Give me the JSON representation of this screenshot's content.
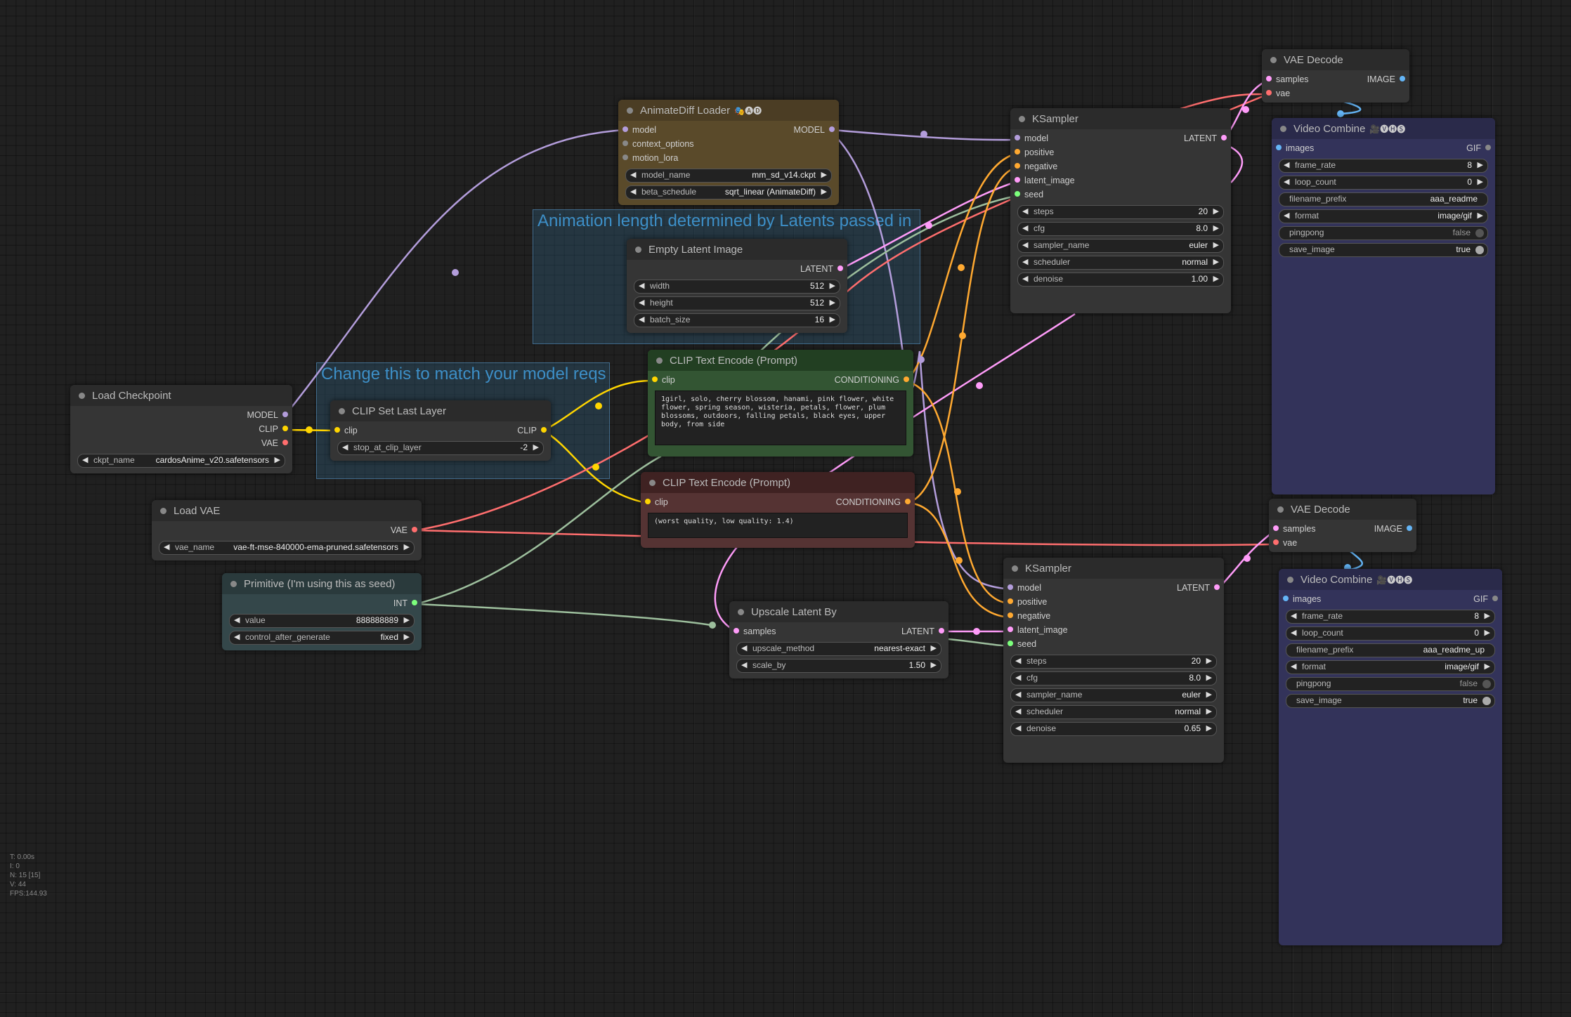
{
  "groups": {
    "animation": {
      "title": "Animation length determined by Latents passed in"
    },
    "change": {
      "title": "Change this to match your model reqs"
    }
  },
  "nodes": {
    "load_checkpoint": {
      "title": "Load Checkpoint",
      "outputs": [
        "MODEL",
        "CLIP",
        "VAE"
      ],
      "ckpt_name_label": "ckpt_name",
      "ckpt_name": "cardosAnime_v20.safetensors"
    },
    "clip_set_last_layer": {
      "title": "CLIP Set Last Layer",
      "input": "clip",
      "output": "CLIP",
      "stop_label": "stop_at_clip_layer",
      "stop_value": "-2"
    },
    "load_vae": {
      "title": "Load VAE",
      "output": "VAE",
      "vae_name_label": "vae_name",
      "vae_name": "vae-ft-mse-840000-ema-pruned.safetensors"
    },
    "primitive": {
      "title": "Primitive (I'm using this as seed)",
      "output": "INT",
      "value_label": "value",
      "value": "888888889",
      "cag_label": "control_after_generate",
      "cag_value": "fixed"
    },
    "animatediff": {
      "title": "AnimateDiff Loader",
      "badge": "🎭🅐🅓",
      "inputs": [
        "model",
        "context_options",
        "motion_lora"
      ],
      "output": "MODEL",
      "model_name_label": "model_name",
      "model_name": "mm_sd_v14.ckpt",
      "beta_label": "beta_schedule",
      "beta_value": "sqrt_linear (AnimateDiff)"
    },
    "empty_latent": {
      "title": "Empty Latent Image",
      "output": "LATENT",
      "width_label": "width",
      "width": "512",
      "height_label": "height",
      "height": "512",
      "batch_label": "batch_size",
      "batch": "16"
    },
    "clip_pos": {
      "title": "CLIP Text Encode (Prompt)",
      "input": "clip",
      "output": "CONDITIONING",
      "text": "1girl, solo, cherry blossom, hanami, pink flower, white flower, spring season, wisteria, petals, flower, plum blossoms, outdoors, falling petals, black eyes, upper body, from side"
    },
    "clip_neg": {
      "title": "CLIP Text Encode (Prompt)",
      "input": "clip",
      "output": "CONDITIONING",
      "text": "(worst quality, low quality: 1.4)"
    },
    "upscale": {
      "title": "Upscale Latent By",
      "input": "samples",
      "output": "LATENT",
      "method_label": "upscale_method",
      "method": "nearest-exact",
      "scale_label": "scale_by",
      "scale": "1.50"
    },
    "ksampler1": {
      "title": "KSampler",
      "inputs": [
        "model",
        "positive",
        "negative",
        "latent_image",
        "seed"
      ],
      "output": "LATENT",
      "steps_label": "steps",
      "steps": "20",
      "cfg_label": "cfg",
      "cfg": "8.0",
      "sampler_label": "sampler_name",
      "sampler": "euler",
      "scheduler_label": "scheduler",
      "scheduler": "normal",
      "denoise_label": "denoise",
      "denoise": "1.00"
    },
    "ksampler2": {
      "title": "KSampler",
      "inputs": [
        "model",
        "positive",
        "negative",
        "latent_image",
        "seed"
      ],
      "output": "LATENT",
      "steps_label": "steps",
      "steps": "20",
      "cfg_label": "cfg",
      "cfg": "8.0",
      "sampler_label": "sampler_name",
      "sampler": "euler",
      "scheduler_label": "scheduler",
      "scheduler": "normal",
      "denoise_label": "denoise",
      "denoise": "0.65"
    },
    "vae_decode1": {
      "title": "VAE Decode",
      "inputs": [
        "samples",
        "vae"
      ],
      "output": "IMAGE"
    },
    "vae_decode2": {
      "title": "VAE Decode",
      "inputs": [
        "samples",
        "vae"
      ],
      "output": "IMAGE"
    },
    "video1": {
      "title": "Video Combine",
      "badge": "🎥🅥🅗🅢",
      "input": "images",
      "output": "GIF",
      "frame_rate_label": "frame_rate",
      "frame_rate": "8",
      "loop_label": "loop_count",
      "loop": "0",
      "prefix_label": "filename_prefix",
      "prefix": "aaa_readme",
      "format_label": "format",
      "format": "image/gif",
      "pingpong_label": "pingpong",
      "pingpong": "false",
      "save_label": "save_image",
      "save": "true"
    },
    "video2": {
      "title": "Video Combine",
      "badge": "🎥🅥🅗🅢",
      "input": "images",
      "output": "GIF",
      "frame_rate_label": "frame_rate",
      "frame_rate": "8",
      "loop_label": "loop_count",
      "loop": "0",
      "prefix_label": "filename_prefix",
      "prefix": "aaa_readme_up",
      "format_label": "format",
      "format": "image/gif",
      "pingpong_label": "pingpong",
      "pingpong": "false",
      "save_label": "save_image",
      "save": "true"
    }
  },
  "stats": [
    "T: 0.00s",
    "I: 0",
    "N: 15 [15]",
    "V: 44",
    "FPS:144.93"
  ],
  "colors": {
    "model": "#b39ddb",
    "clip": "#ffd500",
    "vae": "#ff6e6e",
    "latent": "#ff9cf9",
    "conditioning": "#ffa931",
    "image": "#64b5f6",
    "int": "#9dbf9d"
  }
}
